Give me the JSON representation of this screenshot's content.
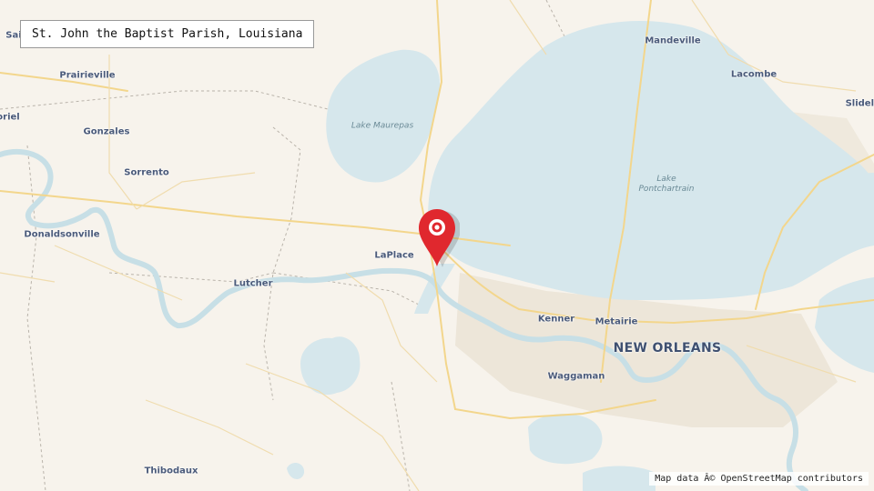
{
  "title": "St. John the Baptist Parish, Louisiana",
  "attribution": "Map data Â© OpenStreetMap contributors",
  "colors": {
    "land": "#f7f3ec",
    "water": "#d6e7ec",
    "river": "#c7dfe6",
    "urban": "#ece5d8",
    "major_road": "#f5d98a",
    "minor_road": "#f0d9a8",
    "border": "#b9b3aa",
    "pin": "#e0282e"
  },
  "places": {
    "mandeville": "Mandeville",
    "lacombe": "Lacombe",
    "slidell": "Slidell",
    "prairieville": "Prairieville",
    "gonzales": "Gonzales",
    "sorrento": "Sorrento",
    "donaldsonville": "Donaldsonville",
    "laplace": "LaPlace",
    "lutcher": "Lutcher",
    "kenner": "Kenner",
    "metairie": "Metairie",
    "new_orleans": "NEW ORLEANS",
    "waggaman": "Waggaman",
    "thibodaux": "Thibodaux",
    "sai": "Sai",
    "oriel": "oriel"
  },
  "water_labels": {
    "lake_maurepas": "Lake Maurepas",
    "lake_pontchartrain_1": "Lake",
    "lake_pontchartrain_2": "Pontchartrain"
  },
  "marker": {
    "icon": "map-pin-icon"
  }
}
